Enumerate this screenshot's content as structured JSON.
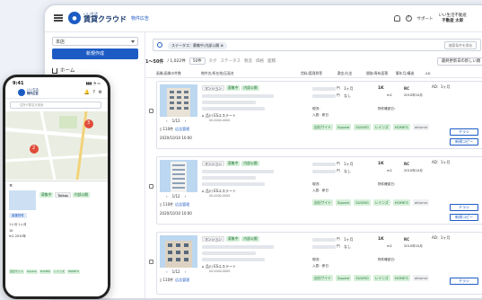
{
  "app": {
    "brand_small": "いい生活",
    "brand_title": "賃貸クラウド",
    "brand_sub": "物件広告",
    "support_label": "サポート",
    "user_line1": "いい生活不動産",
    "user_line2": "不動産 太郎"
  },
  "sidebar": {
    "store_select": "本店",
    "new_listing_button": "新規作成",
    "home_label": "ホーム"
  },
  "search": {
    "chip_label": "ステータス：募集中,内部公開",
    "saved_search_button": "検索条件を保存"
  },
  "list": {
    "count_text": "1〜50件",
    "total_text": "/ 1,022件",
    "per_page": "50件",
    "filters": [
      "タグ",
      "ステータス",
      "製造",
      "価格",
      "面積"
    ],
    "sort_label": "最終更新日の新しい順",
    "headers": [
      "画像/画像の件数",
      "物件名/所在地/区画名",
      "賃料/管理費等",
      "敷金/礼金",
      "間取/専有面積",
      "築年月/構造",
      "AD"
    ]
  },
  "listings": [
    {
      "type": "マンション",
      "status": "募集中",
      "visibility": "内部公開",
      "photo_page": "1/12",
      "address": "品川 ESエステート",
      "address_sub": "00-0000-0000",
      "views": "110件",
      "ad_manage": "広告管理",
      "date": "2020/10/10 10:00",
      "rent_unit": "円",
      "fee_unit": "円",
      "deposit": "1ヶ月",
      "key_money": "なし",
      "layout": "1K",
      "area_unit": "m2",
      "structure": "RC",
      "built": "2010年10月",
      "ad": "AD：1ヶ月",
      "status_label": "現況：",
      "move_in": "入居：即日",
      "land_label": "物件確認日：",
      "portals": [
        "自社サイト",
        "Square",
        "SUUMO",
        "レインズ",
        "HOME'S",
        "athome"
      ],
      "flyer_button": "チラシ",
      "copy_button": "新規コピー"
    },
    {
      "type": "マンション",
      "status": "募集中",
      "visibility": "内部公開",
      "photo_page": "1/12",
      "address": "品川 ESエステート",
      "address_sub": "00-0000-0000",
      "views": "110件",
      "ad_manage": "広告管理",
      "date": "2020/10/10 10:00",
      "rent_unit": "円",
      "fee_unit": "円",
      "deposit": "1ヶ月",
      "key_money": "なし",
      "layout": "1K",
      "area_unit": "m2",
      "structure": "RC",
      "built": "2010年10月",
      "ad": "AD：1ヶ月",
      "status_label": "現況：",
      "move_in": "入居：即日",
      "land_label": "物件確認日：",
      "portals": [
        "自社サイト",
        "Square",
        "SUUMO",
        "レインズ",
        "HOME'S",
        "athome"
      ],
      "flyer_button": "チラシ",
      "copy_button": "新規コピー"
    },
    {
      "type": "マンション",
      "status": "募集中",
      "visibility": "内部公開",
      "photo_page": "1/12",
      "address": "品川 ESエステート",
      "address_sub": "00-0000-0000",
      "views": "110件",
      "ad_manage": "広告管理",
      "date": "2020/10/10 10:00",
      "rent_unit": "円",
      "fee_unit": "円",
      "deposit": "1ヶ月",
      "key_money": "なし",
      "layout": "1K",
      "area_unit": "m2",
      "structure": "RC",
      "built": "2010年10月",
      "ad": "AD：1ヶ月",
      "status_label": "現況：",
      "move_in": "入居：即日",
      "land_label": "物件確認日：",
      "portals": [
        "自社サイト",
        "Square",
        "SUUMO",
        "レインズ",
        "HOME'S",
        "athome"
      ],
      "flyer_button": "チラシ"
    }
  ],
  "phone": {
    "time": "9:41",
    "status_icons": "▮▮▮ ◔ ▭",
    "brand_small": "いい生活",
    "brand_title": "物件広告",
    "search_placeholder": "住所や駅名を検索",
    "sheet_tags": [
      "募集中",
      "Tolkas",
      "内部公開"
    ],
    "sheet_button": "募集物件",
    "facts": [
      "1ヶ月  1ヶ月",
      "1K",
      "m2  2010年"
    ],
    "portals": [
      "自社サイト",
      "Square",
      "SUUMO",
      "レインズ",
      "HOME'S"
    ],
    "map_pins": [
      "2",
      "3"
    ]
  },
  "colors": {
    "brand": "#1d5bc4",
    "green_tag": "#267a3c",
    "pin": "#e04b3a"
  }
}
